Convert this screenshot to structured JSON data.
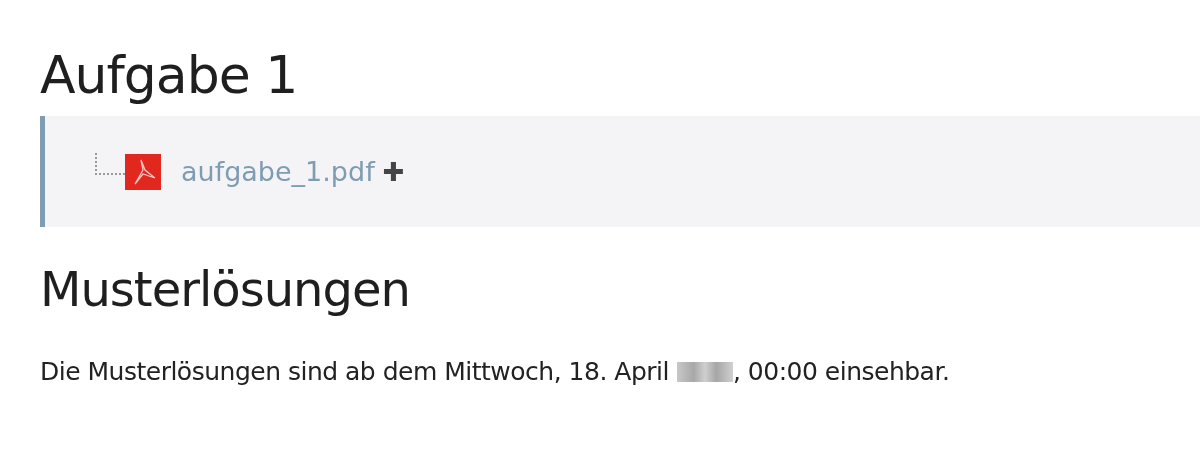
{
  "section_title": "Aufgabe 1",
  "files": [
    {
      "name": "aufgabe_1.pdf",
      "kind": "pdf",
      "action": "✚"
    }
  ],
  "solutions_title": "Musterlösungen",
  "notice": {
    "before": "Die Musterlösungen sind ab dem Mittwoch, 18. April",
    "redacted": true,
    "after": ", 00:00 einsehbar."
  }
}
